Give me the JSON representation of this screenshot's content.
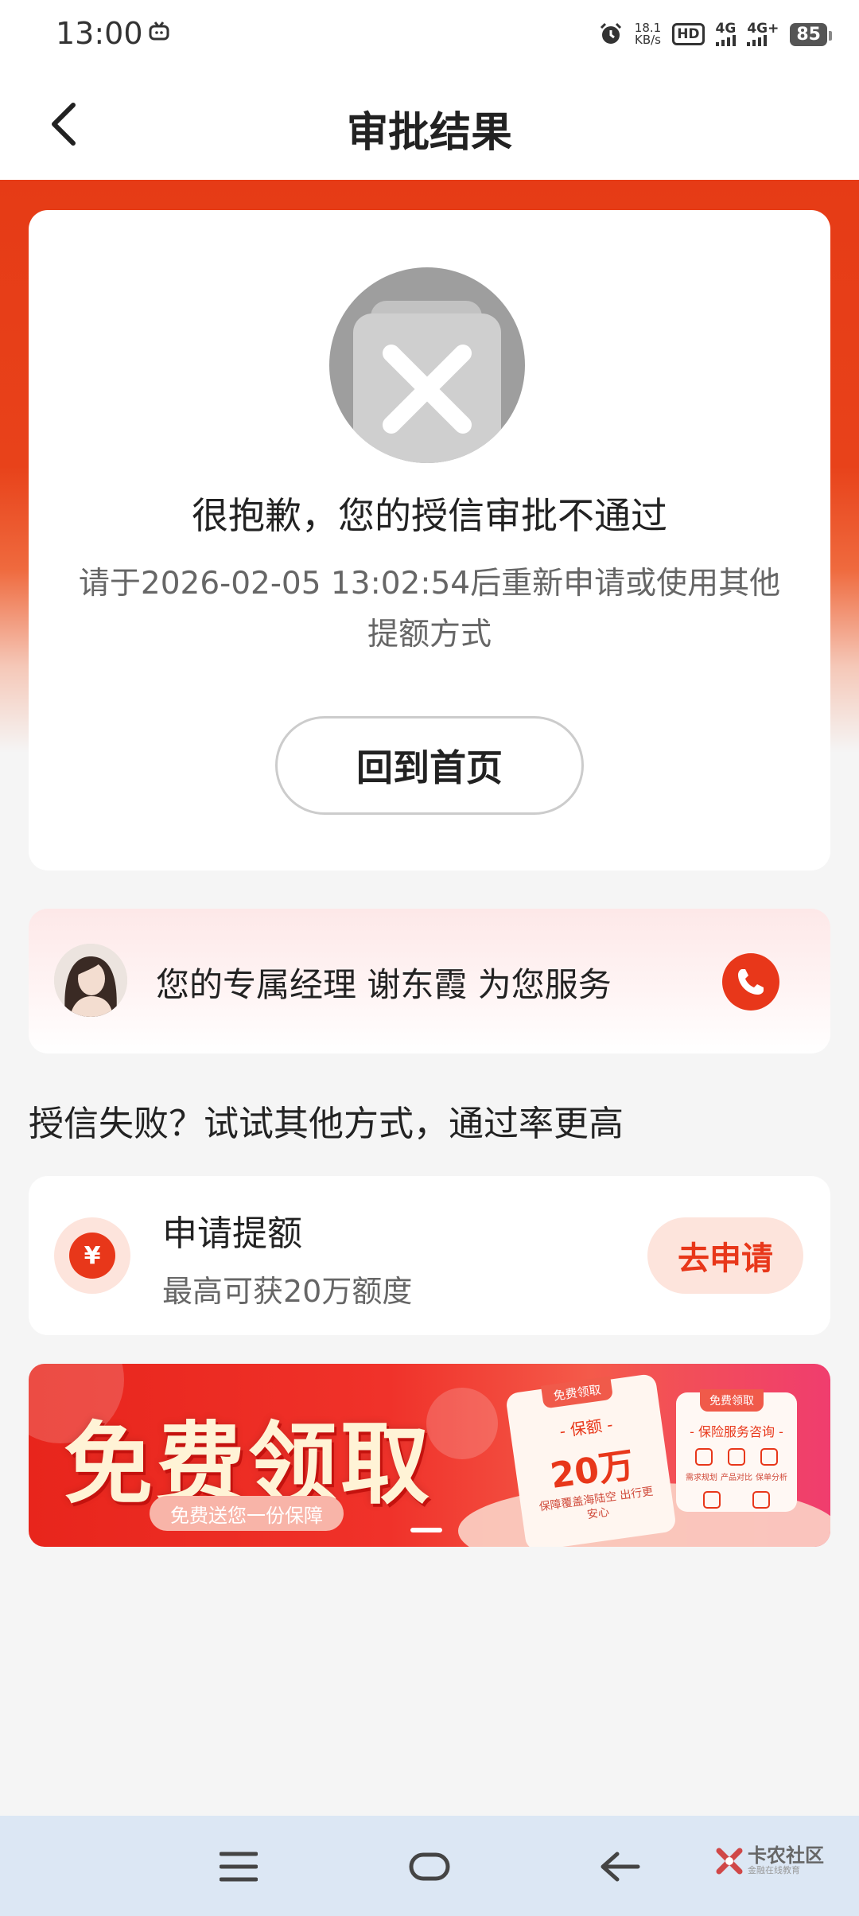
{
  "status_bar": {
    "time": "13:00",
    "net_speed": "18.1",
    "net_speed_unit": "KB/s",
    "hd_label": "HD",
    "net1": "4G",
    "net2": "4G+",
    "battery": "85"
  },
  "header": {
    "title": "审批结果",
    "back_icon": "chevron-left-icon"
  },
  "result": {
    "title": "很抱歉，您的授信审批不通过",
    "description": "请于2026-02-05 13:02:54后重新申请或使用其他提额方式",
    "home_button": "回到首页",
    "icon": "close-icon"
  },
  "manager": {
    "text": "您的专属经理 谢东霞 为您服务",
    "call_icon": "phone-icon"
  },
  "alternatives": {
    "section_title": "授信失败？试试其他方式，通过率更高",
    "offer_title": "申请提额",
    "offer_subtitle": "最高可获20万额度",
    "apply_button": "去申请",
    "icon_symbol": "¥"
  },
  "banner": {
    "title": "免费领取",
    "pill": "免费送您一份保障",
    "card1_tag": "免费领取",
    "card1_label": "- 保额 -",
    "card1_amount": "20万",
    "card1_note": "保障覆盖海陆空 出行更安心",
    "card2_tag": "免费领取",
    "card2_label": "- 保险服务咨询 -",
    "card2_captions": [
      "需求规划",
      "产品对比",
      "保单分析"
    ]
  },
  "watermark": {
    "name": "卡农社区",
    "tagline": "金融在线教育"
  },
  "colors": {
    "accent_red": "#e8371a",
    "header_red": "#e63b16",
    "light_pink": "#fde4dc"
  }
}
